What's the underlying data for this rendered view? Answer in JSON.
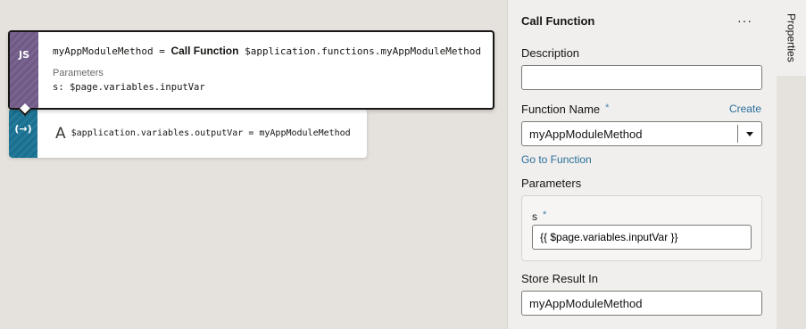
{
  "canvas": {
    "call_node": {
      "icon": "JS",
      "target": "myAppModuleMethod",
      "equals": "=",
      "action": "Call Function",
      "path": "$application.functions.myAppModuleMethod",
      "params_label": "Parameters",
      "param_line": "s: $page.variables.inputVar"
    },
    "assign_node": {
      "icon": "(→)",
      "type_icon": "A",
      "text": "$application.variables.outputVar = myAppModuleMethod"
    }
  },
  "panel": {
    "title": "Call Function",
    "more": "···",
    "description_label": "Description",
    "description_value": "",
    "function_name_label": "Function Name",
    "required_mark": "*",
    "create_link": "Create",
    "function_name_value": "myAppModuleMethod",
    "goto_link": "Go to Function",
    "parameters_label": "Parameters",
    "param_name": "s",
    "param_value": "{{ $page.variables.inputVar }}",
    "store_result_label": "Store Result In",
    "store_result_value": "myAppModuleMethod"
  },
  "side_tabs": {
    "properties": "Properties"
  }
}
